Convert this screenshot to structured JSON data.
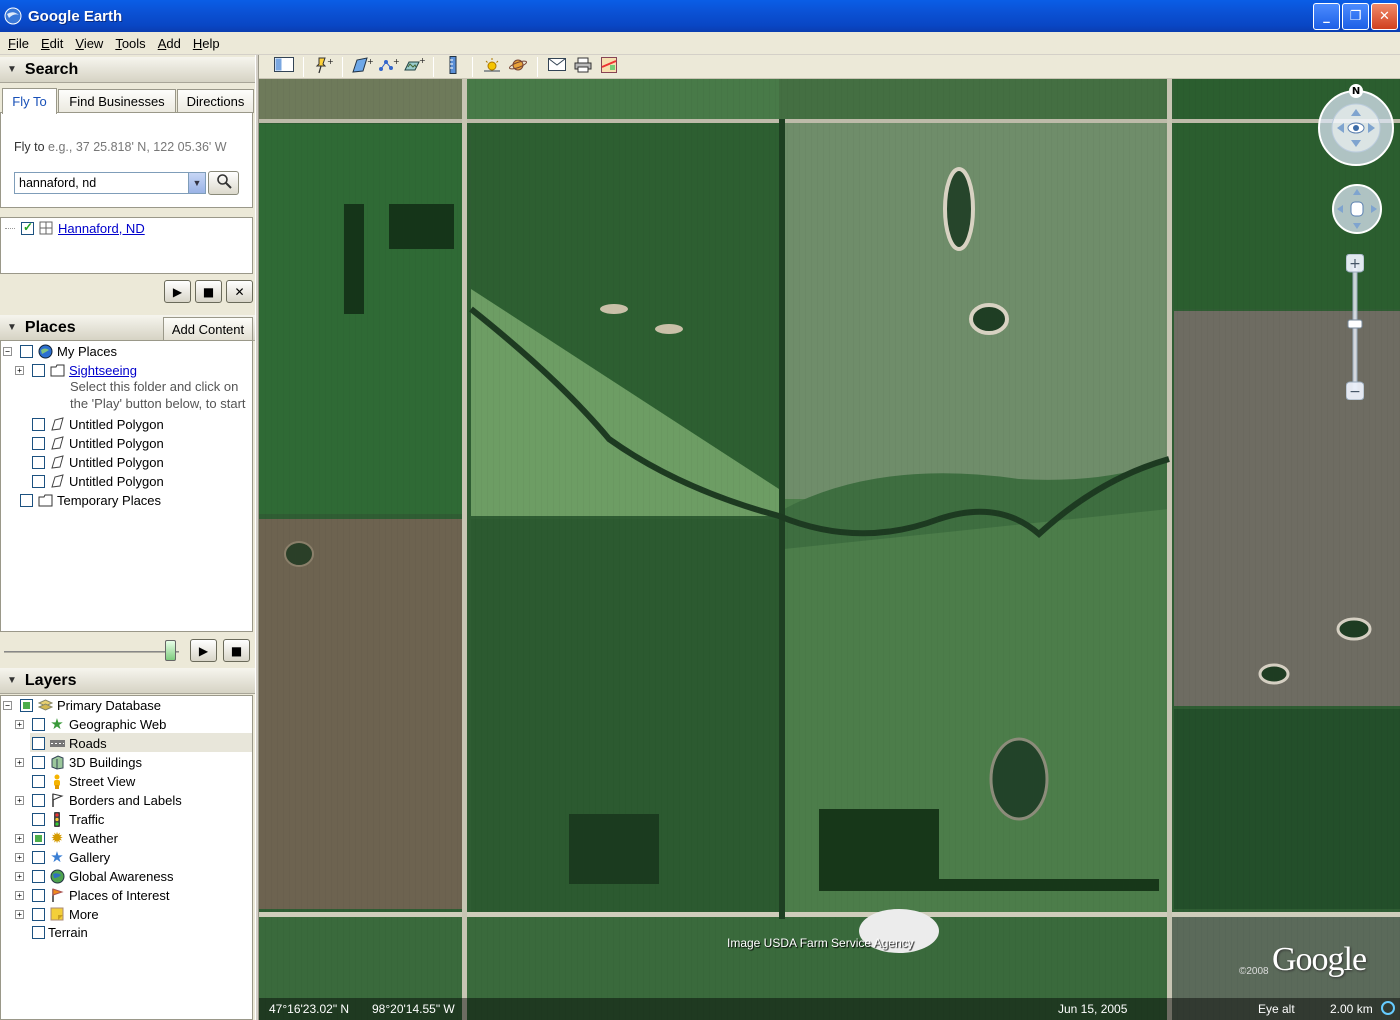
{
  "window": {
    "title": "Google Earth"
  },
  "menu": [
    {
      "pre": "",
      "u": "F",
      "post": "ile"
    },
    {
      "pre": "",
      "u": "E",
      "post": "dit"
    },
    {
      "pre": "",
      "u": "V",
      "post": "iew"
    },
    {
      "pre": "",
      "u": "T",
      "post": "ools"
    },
    {
      "pre": "",
      "u": "A",
      "post": "dd"
    },
    {
      "pre": "",
      "u": "H",
      "post": "elp"
    }
  ],
  "search": {
    "header": "Search",
    "tabs": [
      "Fly To",
      "Find Businesses",
      "Directions"
    ],
    "active_tab": "Fly To",
    "flyto_label": "Fly to",
    "flyto_example": "e.g., 37 25.818' N, 122 05.36' W",
    "query": "hannaford, nd",
    "result": "Hannaford, ND"
  },
  "places": {
    "header": "Places",
    "add_content": "Add Content",
    "items": {
      "my_places": "My Places",
      "sightseeing": "Sightseeing",
      "hint1": "Select this folder and click on",
      "hint2": "the 'Play' button below, to start",
      "poly1": "Untitled Polygon",
      "poly2": "Untitled Polygon",
      "poly3": "Untitled Polygon",
      "poly4": "Untitled Polygon",
      "temporary": "Temporary Places"
    },
    "tour_progress": 0.95
  },
  "layers": {
    "header": "Layers",
    "items": {
      "primary": "Primary Database",
      "geoweb": "Geographic Web",
      "roads": "Roads",
      "buildings": "3D Buildings",
      "streetview": "Street View",
      "borders": "Borders and Labels",
      "traffic": "Traffic",
      "weather": "Weather",
      "gallery": "Gallery",
      "global": "Global Awareness",
      "poi": "Places of Interest",
      "more": "More",
      "terrain": "Terrain"
    }
  },
  "map": {
    "credit": "Image USDA Farm Service Agency",
    "logo": "Google",
    "logo_year": "©2008",
    "status": {
      "lat": "47°16'23.02\" N",
      "lon": "98°20'14.55\" W",
      "date": "Jun 15, 2005",
      "eye_alt_label": "Eye alt",
      "eye_alt_value": "2.00 km"
    },
    "compass_n": "N"
  },
  "colors": {
    "titlebar": "#0b51d4",
    "panel": "#ece9d8",
    "link": "#0000cc"
  }
}
